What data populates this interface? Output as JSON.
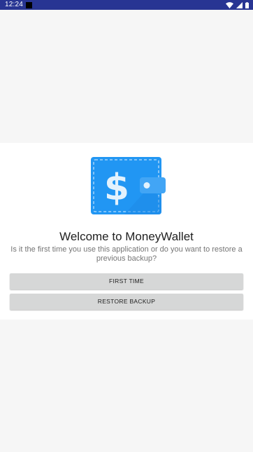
{
  "status_bar": {
    "time": "12:24",
    "icons": [
      "notification-square-icon",
      "wifi-icon",
      "cell-signal-icon",
      "battery-icon"
    ],
    "color": "#283593"
  },
  "welcome": {
    "logo_icon": "wallet-dollar-icon",
    "title": "Welcome to MoneyWallet",
    "subtitle": "Is it the first time you use this application or do you want to restore a previous backup?"
  },
  "actions": {
    "first_time_label": "FIRST TIME",
    "restore_backup_label": "RESTORE BACKUP"
  },
  "colors": {
    "logo_blue": "#2196f3",
    "button_bg": "#d6d7d7",
    "background": "#f6f6f6"
  }
}
